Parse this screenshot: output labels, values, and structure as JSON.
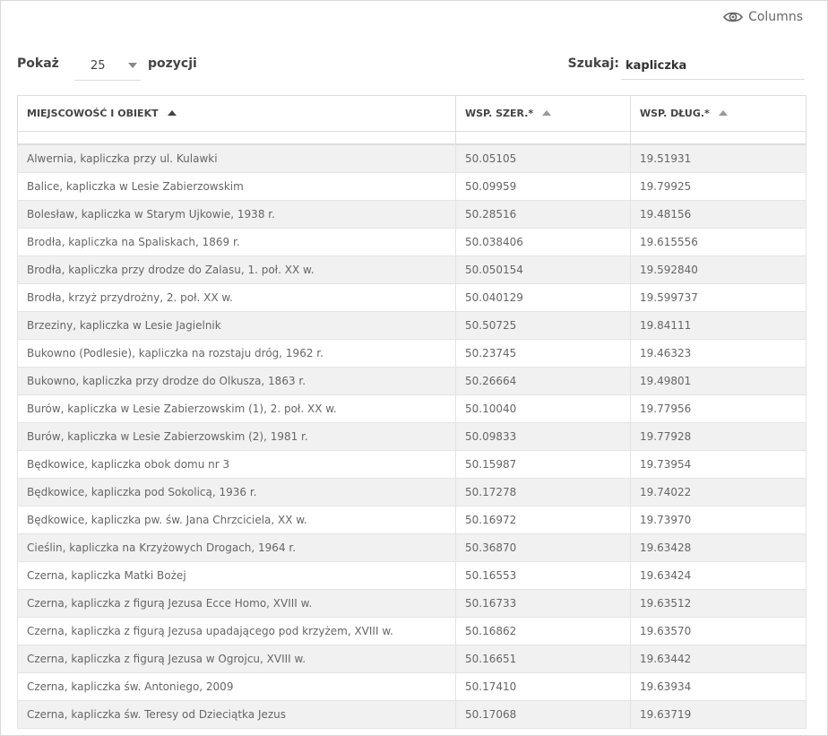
{
  "toolbar": {
    "columns_label": "Columns",
    "length_label_before": "Pokaż",
    "length_value": "25",
    "length_label_after": "pozycji",
    "search_label": "Szukaj:",
    "search_value": "kapliczka"
  },
  "table": {
    "headers": [
      "MIEJSCOWOŚĆ I OBIEKT",
      "WSP. SZER.*",
      "WSP. DŁUG.*"
    ],
    "rows": [
      [
        "Alwernia, kapliczka przy ul. Kulawki",
        "50.05105",
        "19.51931"
      ],
      [
        "Balice, kapliczka w Lesie Zabierzowskim",
        "50.09959",
        "19.79925"
      ],
      [
        "Bolesław, kapliczka w Starym Ujkowie, 1938 r.",
        "50.28516",
        "19.48156"
      ],
      [
        "Brodła, kapliczka na Spaliskach, 1869 r.",
        "50.038406",
        "19.615556"
      ],
      [
        "Brodła, kapliczka przy drodze do Zalasu, 1. poł. XX w.",
        "50.050154",
        "19.592840"
      ],
      [
        "Brodła, krzyż przydrożny, 2. poł. XX w.",
        "50.040129",
        "19.599737"
      ],
      [
        "Brzeziny, kapliczka w Lesie Jagielnik",
        "50.50725",
        "19.84111"
      ],
      [
        "Bukowno (Podlesie), kapliczka na rozstaju dróg, 1962 r.",
        "50.23745",
        "19.46323"
      ],
      [
        "Bukowno, kapliczka przy drodze do Olkusza, 1863 r.",
        "50.26664",
        "19.49801"
      ],
      [
        "Burów, kapliczka w Lesie Zabierzowskim (1), 2. poł. XX w.",
        "50.10040",
        "19.77956"
      ],
      [
        "Burów, kapliczka w Lesie Zabierzowskim (2), 1981 r.",
        "50.09833",
        "19.77928"
      ],
      [
        "Będkowice, kapliczka obok domu nr 3",
        "50.15987",
        "19.73954"
      ],
      [
        "Będkowice, kapliczka pod Sokolicą, 1936 r.",
        "50.17278",
        "19.74022"
      ],
      [
        "Będkowice, kapliczka pw. św. Jana Chrzciciela, XX w.",
        "50.16972",
        "19.73970"
      ],
      [
        "Cieślin, kapliczka na Krzyżowych Drogach, 1964 r.",
        "50.36870",
        "19.63428"
      ],
      [
        "Czerna, kapliczka Matki Bożej",
        "50.16553",
        "19.63424"
      ],
      [
        "Czerna, kapliczka z figurą Jezusa Ecce Homo, XVIII w.",
        "50.16733",
        "19.63512"
      ],
      [
        "Czerna, kapliczka z figurą Jezusa upadającego pod krzyżem, XVIII w.",
        "50.16862",
        "19.63570"
      ],
      [
        "Czerna, kapliczka z figurą Jezusa w Ogrojcu, XVIII w.",
        "50.16651",
        "19.63442"
      ],
      [
        "Czerna, kapliczka św. Antoniego, 2009",
        "50.17410",
        "19.63934"
      ],
      [
        "Czerna, kapliczka św. Teresy od Dzieciątka Jezus",
        "50.17068",
        "19.63719"
      ]
    ]
  }
}
